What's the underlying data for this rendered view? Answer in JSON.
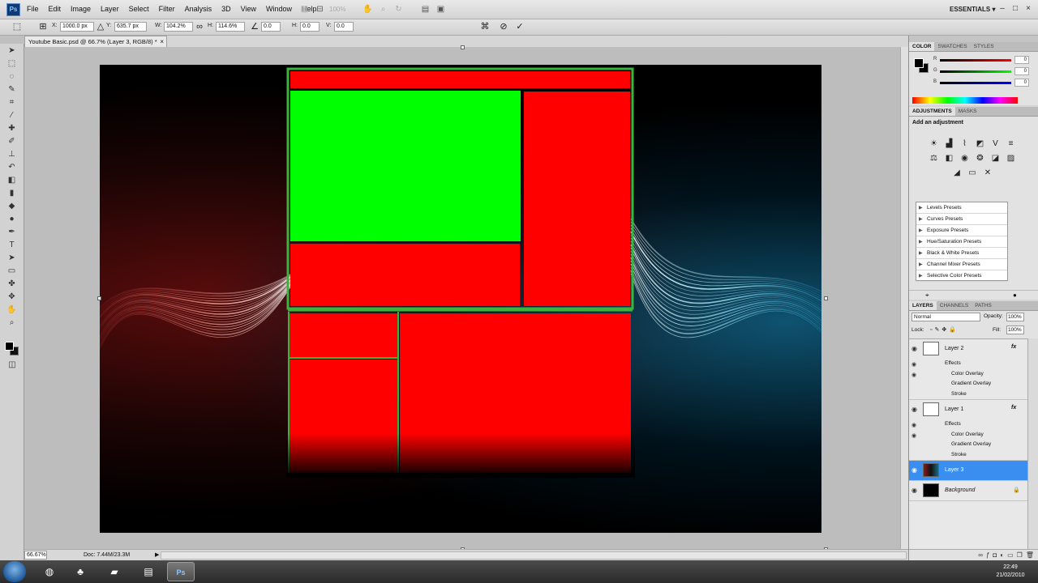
{
  "menu": {
    "app_logo": "Ps",
    "items": [
      "File",
      "Edit",
      "Image",
      "Layer",
      "Select",
      "Filter",
      "Analysis",
      "3D",
      "View",
      "Window",
      "Help"
    ],
    "zoom": "100%",
    "workspace": "ESSENTIALS ▾"
  },
  "options": {
    "x_label": "X:",
    "x_value": "1000.0 px",
    "y_label": "Y:",
    "y_value": "635.7 px",
    "w_label": "W:",
    "w_value": "104.2%",
    "h_label": "H:",
    "h_value": "114.6%",
    "angle_value": "0.0",
    "h_skew_label": "H:",
    "h_skew_value": "0.0",
    "v_skew_label": "V:",
    "v_skew_value": "0.0"
  },
  "document": {
    "tab_title": "Youtube Basic.psd @ 66.7% (Layer 3, RGB/8) *",
    "close": "×"
  },
  "status": {
    "zoom": "66.67%",
    "doc_size": "Doc: 7.44M/23.3M"
  },
  "color_panel": {
    "tabs": [
      "COLOR",
      "SWATCHES",
      "STYLES"
    ],
    "rows": [
      {
        "label": "R",
        "value": "0"
      },
      {
        "label": "G",
        "value": "0"
      },
      {
        "label": "B",
        "value": "0"
      }
    ]
  },
  "adjustments": {
    "tabs": [
      "ADJUSTMENTS",
      "MASKS"
    ],
    "title": "Add an adjustment",
    "presets": [
      "Levels Presets",
      "Curves Presets",
      "Exposure Presets",
      "Hue/Saturation Presets",
      "Black & White Presets",
      "Channel Mixer Presets",
      "Selective Color Presets"
    ]
  },
  "layers": {
    "tabs": [
      "LAYERS",
      "CHANNELS",
      "PATHS"
    ],
    "blend_mode": "Normal",
    "opacity_label": "Opacity:",
    "opacity": "100%",
    "lock_label": "Lock:",
    "fill_label": "Fill:",
    "fill": "100%",
    "layer2": {
      "name": "Layer 2",
      "fx": "fx",
      "effects": "Effects",
      "items": [
        "Color Overlay",
        "Gradient Overlay",
        "Stroke"
      ]
    },
    "layer1": {
      "name": "Layer 1",
      "fx": "fx",
      "effects": "Effects",
      "items": [
        "Color Overlay",
        "Gradient Overlay",
        "Stroke"
      ]
    },
    "layer3": {
      "name": "Layer 3"
    },
    "background": {
      "name": "Background"
    }
  },
  "taskbar": {
    "time": "22:49",
    "date": "21/02/2010"
  },
  "colors": {
    "red_block": "#ff0000",
    "green_block": "#00ff00",
    "border_green": "#3cb43c",
    "selection": "#3a8ef0"
  }
}
